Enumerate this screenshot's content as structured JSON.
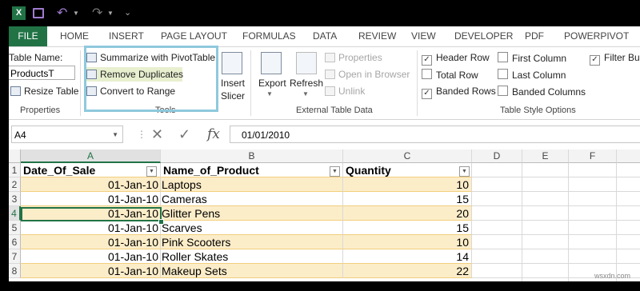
{
  "quick_access": {
    "app_icon": "X",
    "save_icon": "save-icon",
    "undo_icon": "undo-icon",
    "redo_icon": "redo-icon"
  },
  "tabs": [
    "FILE",
    "HOME",
    "INSERT",
    "PAGE LAYOUT",
    "FORMULAS",
    "DATA",
    "REVIEW",
    "VIEW",
    "DEVELOPER",
    "PDF",
    "POWERPIVOT"
  ],
  "ribbon": {
    "properties": {
      "table_name_label": "Table Name:",
      "table_name_value": "ProductsT",
      "resize_label": "Resize Table",
      "group_label": "Properties"
    },
    "tools": {
      "summarize": "Summarize with PivotTable",
      "remove_duplicates": "Remove Duplicates",
      "convert": "Convert to Range",
      "group_label": "Tools"
    },
    "insert_slicer": {
      "line1": "Insert",
      "line2": "Slicer"
    },
    "external": {
      "export": "Export",
      "refresh": "Refresh",
      "properties": "Properties",
      "open_browser": "Open in Browser",
      "unlink": "Unlink",
      "group_label": "External Table Data"
    },
    "style_options": {
      "header_row": "Header Row",
      "total_row": "Total Row",
      "banded_rows": "Banded Rows",
      "first_column": "First Column",
      "last_column": "Last Column",
      "banded_columns": "Banded Columns",
      "filter_button": "Filter Bu",
      "group_label": "Table Style Options"
    }
  },
  "formula_bar": {
    "name_box": "A4",
    "value": "01/01/2010",
    "fx": "fx"
  },
  "columns": [
    "A",
    "B",
    "C",
    "D",
    "E",
    "F"
  ],
  "rows": [
    "1",
    "2",
    "3",
    "4",
    "5",
    "6",
    "7",
    "8"
  ],
  "table": {
    "headers": [
      "Date_Of_Sale",
      "Name_of_Product",
      "Quantity"
    ],
    "data": [
      [
        "01-Jan-10",
        "Laptops",
        "10"
      ],
      [
        "01-Jan-10",
        "Cameras",
        "15"
      ],
      [
        "01-Jan-10",
        "Glitter Pens",
        "20"
      ],
      [
        "01-Jan-10",
        "Scarves",
        "15"
      ],
      [
        "01-Jan-10",
        "Pink Scooters",
        "10"
      ],
      [
        "01-Jan-10",
        "Roller Skates",
        "14"
      ],
      [
        "01-Jan-10",
        "Makeup Sets",
        "22"
      ]
    ]
  },
  "colors": {
    "excel_green": "#217346",
    "band": "#fcedc9",
    "highlight": "#8fc9dd"
  },
  "watermark": "wsxdn.com"
}
